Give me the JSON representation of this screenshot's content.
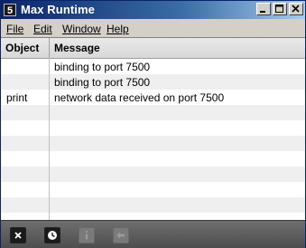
{
  "window": {
    "title": "Max Runtime",
    "icon_glyph": "5"
  },
  "menubar": {
    "items": [
      {
        "label": "File"
      },
      {
        "label": "Edit"
      },
      {
        "label": "Window"
      },
      {
        "label": "Help"
      }
    ]
  },
  "table": {
    "columns": [
      "Object",
      "Message"
    ],
    "rows": [
      {
        "object": "",
        "message": "binding to port 7500"
      },
      {
        "object": "",
        "message": "binding to port 7500"
      },
      {
        "object": "print",
        "message": "network data received on port 7500"
      },
      {
        "object": "",
        "message": ""
      },
      {
        "object": "",
        "message": ""
      },
      {
        "object": "",
        "message": ""
      },
      {
        "object": "",
        "message": ""
      },
      {
        "object": "",
        "message": ""
      },
      {
        "object": "",
        "message": ""
      },
      {
        "object": "",
        "message": ""
      },
      {
        "object": "",
        "message": ""
      }
    ]
  },
  "toolbar": {
    "buttons": [
      {
        "icon": "clear-icon",
        "enabled": true
      },
      {
        "icon": "clock-icon",
        "enabled": true
      },
      {
        "icon": "info-icon",
        "enabled": false
      },
      {
        "icon": "back-arrow-icon",
        "enabled": false
      }
    ]
  },
  "colors": {
    "titlebar_start": "#0a246a",
    "titlebar_end": "#a6caf0",
    "row_alt": "#efefef",
    "toolbar_bg": "#5a5a5a"
  }
}
